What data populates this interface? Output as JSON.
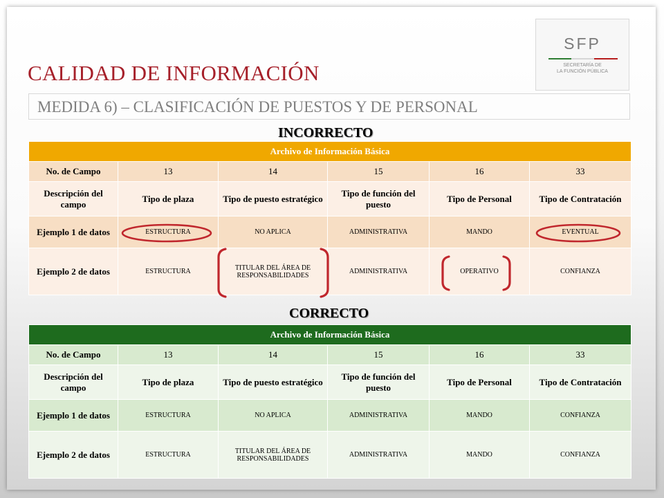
{
  "slide": {
    "title": "CALIDAD DE INFORMACIÓN",
    "subtitle": "MEDIDA 6) – CLASIFICACIÓN DE PUESTOS Y DE PERSONAL"
  },
  "logo": {
    "name": "SFP",
    "line1": "SECRETARÍA DE",
    "line2": "LA FUNCIÓN PÚBLICA"
  },
  "colors": {
    "title": "#a6202a",
    "incorrect_band": "#f0a800",
    "correct_band": "#1e6b1e",
    "circle_marks": "#c0272d"
  },
  "incorrect": {
    "label": "INCORRECTO",
    "band": "Archivo de Información Básica",
    "numbers_label": "No. de Campo",
    "numbers": [
      "13",
      "14",
      "15",
      "16",
      "33"
    ],
    "desc_label": "Descripción del campo",
    "descs": [
      "Tipo de plaza",
      "Tipo de puesto estratégico",
      "Tipo de función del puesto",
      "Tipo de Personal",
      "Tipo de Contratación"
    ],
    "ex1_label": "Ejemplo 1 de datos",
    "ex1": [
      "ESTRUCTURA",
      "NO APLICA",
      "ADMINISTRATIVA",
      "MANDO",
      "EVENTUAL"
    ],
    "ex2_label": "Ejemplo 2 de datos",
    "ex2": [
      "ESTRUCTURA",
      "TITULAR DEL ÁREA DE RESPONSABILIDADES",
      "ADMINISTRATIVA",
      "OPERATIVO",
      "CONFIANZA"
    ]
  },
  "correct": {
    "label": "CORRECTO",
    "band": "Archivo de Información Básica",
    "numbers_label": "No. de Campo",
    "numbers": [
      "13",
      "14",
      "15",
      "16",
      "33"
    ],
    "desc_label": "Descripción del campo",
    "descs": [
      "Tipo de plaza",
      "Tipo de puesto estratégico",
      "Tipo de función del puesto",
      "Tipo de Personal",
      "Tipo de Contratación"
    ],
    "ex1_label": "Ejemplo 1 de datos",
    "ex1": [
      "ESTRUCTURA",
      "NO APLICA",
      "ADMINISTRATIVA",
      "MANDO",
      "CONFIANZA"
    ],
    "ex2_label": "Ejemplo 2 de datos",
    "ex2": [
      "ESTRUCTURA",
      "TITULAR DEL ÁREA DE RESPONSABILIDADES",
      "ADMINISTRATIVA",
      "MANDO",
      "CONFIANZA"
    ]
  }
}
